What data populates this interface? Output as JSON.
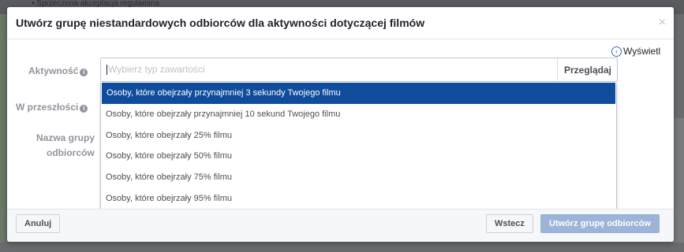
{
  "background": {
    "text_line": "• Sprzeczona akceptacja regulamina"
  },
  "modal": {
    "title": "Utwórz grupę niestandardowych odbiorców dla aktywności dotyczącej filmów",
    "close_glyph": "×",
    "view_link": "Wyświetl",
    "fields": {
      "activity_label": "Aktywność",
      "past_label": "W przeszłości",
      "audience_name_label_1": "Nazwa grupy",
      "audience_name_label_2": "odbiorców"
    },
    "select": {
      "placeholder": "Wybierz typ zawartości",
      "browse_label": "Przeglądaj"
    },
    "options": [
      "Osoby, które obejrzały przynajmniej 3 sekundy Twojego filmu",
      "Osoby, które obejrzały przynajmniej 10 sekund Twojego filmu",
      "Osoby, które obejrzały 25% filmu",
      "Osoby, które obejrzały 50% filmu",
      "Osoby, które obejrzały 75% filmu",
      "Osoby, które obejrzały 95% filmu"
    ],
    "selected_option_index": 0,
    "footer": {
      "cancel_label": "Anuluj",
      "back_label": "Wstecz",
      "create_label": "Utwórz grupę odbiorców"
    }
  },
  "colors": {
    "selected_bg": "#0f4c9c",
    "primary_disabled": "#9cb4d8",
    "link": "#4267b2"
  }
}
